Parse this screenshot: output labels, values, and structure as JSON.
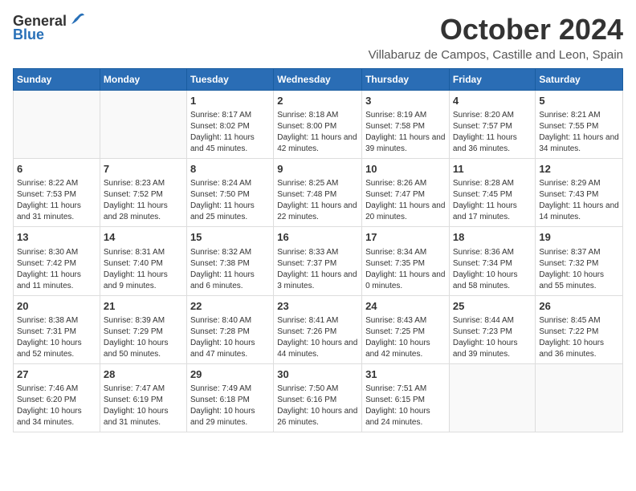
{
  "header": {
    "logo_general": "General",
    "logo_blue": "Blue",
    "month_title": "October 2024",
    "location": "Villabaruz de Campos, Castille and Leon, Spain"
  },
  "weekdays": [
    "Sunday",
    "Monday",
    "Tuesday",
    "Wednesday",
    "Thursday",
    "Friday",
    "Saturday"
  ],
  "weeks": [
    [
      {
        "day": "",
        "sunrise": "",
        "sunset": "",
        "daylight": ""
      },
      {
        "day": "",
        "sunrise": "",
        "sunset": "",
        "daylight": ""
      },
      {
        "day": "1",
        "sunrise": "Sunrise: 8:17 AM",
        "sunset": "Sunset: 8:02 PM",
        "daylight": "Daylight: 11 hours and 45 minutes."
      },
      {
        "day": "2",
        "sunrise": "Sunrise: 8:18 AM",
        "sunset": "Sunset: 8:00 PM",
        "daylight": "Daylight: 11 hours and 42 minutes."
      },
      {
        "day": "3",
        "sunrise": "Sunrise: 8:19 AM",
        "sunset": "Sunset: 7:58 PM",
        "daylight": "Daylight: 11 hours and 39 minutes."
      },
      {
        "day": "4",
        "sunrise": "Sunrise: 8:20 AM",
        "sunset": "Sunset: 7:57 PM",
        "daylight": "Daylight: 11 hours and 36 minutes."
      },
      {
        "day": "5",
        "sunrise": "Sunrise: 8:21 AM",
        "sunset": "Sunset: 7:55 PM",
        "daylight": "Daylight: 11 hours and 34 minutes."
      }
    ],
    [
      {
        "day": "6",
        "sunrise": "Sunrise: 8:22 AM",
        "sunset": "Sunset: 7:53 PM",
        "daylight": "Daylight: 11 hours and 31 minutes."
      },
      {
        "day": "7",
        "sunrise": "Sunrise: 8:23 AM",
        "sunset": "Sunset: 7:52 PM",
        "daylight": "Daylight: 11 hours and 28 minutes."
      },
      {
        "day": "8",
        "sunrise": "Sunrise: 8:24 AM",
        "sunset": "Sunset: 7:50 PM",
        "daylight": "Daylight: 11 hours and 25 minutes."
      },
      {
        "day": "9",
        "sunrise": "Sunrise: 8:25 AM",
        "sunset": "Sunset: 7:48 PM",
        "daylight": "Daylight: 11 hours and 22 minutes."
      },
      {
        "day": "10",
        "sunrise": "Sunrise: 8:26 AM",
        "sunset": "Sunset: 7:47 PM",
        "daylight": "Daylight: 11 hours and 20 minutes."
      },
      {
        "day": "11",
        "sunrise": "Sunrise: 8:28 AM",
        "sunset": "Sunset: 7:45 PM",
        "daylight": "Daylight: 11 hours and 17 minutes."
      },
      {
        "day": "12",
        "sunrise": "Sunrise: 8:29 AM",
        "sunset": "Sunset: 7:43 PM",
        "daylight": "Daylight: 11 hours and 14 minutes."
      }
    ],
    [
      {
        "day": "13",
        "sunrise": "Sunrise: 8:30 AM",
        "sunset": "Sunset: 7:42 PM",
        "daylight": "Daylight: 11 hours and 11 minutes."
      },
      {
        "day": "14",
        "sunrise": "Sunrise: 8:31 AM",
        "sunset": "Sunset: 7:40 PM",
        "daylight": "Daylight: 11 hours and 9 minutes."
      },
      {
        "day": "15",
        "sunrise": "Sunrise: 8:32 AM",
        "sunset": "Sunset: 7:38 PM",
        "daylight": "Daylight: 11 hours and 6 minutes."
      },
      {
        "day": "16",
        "sunrise": "Sunrise: 8:33 AM",
        "sunset": "Sunset: 7:37 PM",
        "daylight": "Daylight: 11 hours and 3 minutes."
      },
      {
        "day": "17",
        "sunrise": "Sunrise: 8:34 AM",
        "sunset": "Sunset: 7:35 PM",
        "daylight": "Daylight: 11 hours and 0 minutes."
      },
      {
        "day": "18",
        "sunrise": "Sunrise: 8:36 AM",
        "sunset": "Sunset: 7:34 PM",
        "daylight": "Daylight: 10 hours and 58 minutes."
      },
      {
        "day": "19",
        "sunrise": "Sunrise: 8:37 AM",
        "sunset": "Sunset: 7:32 PM",
        "daylight": "Daylight: 10 hours and 55 minutes."
      }
    ],
    [
      {
        "day": "20",
        "sunrise": "Sunrise: 8:38 AM",
        "sunset": "Sunset: 7:31 PM",
        "daylight": "Daylight: 10 hours and 52 minutes."
      },
      {
        "day": "21",
        "sunrise": "Sunrise: 8:39 AM",
        "sunset": "Sunset: 7:29 PM",
        "daylight": "Daylight: 10 hours and 50 minutes."
      },
      {
        "day": "22",
        "sunrise": "Sunrise: 8:40 AM",
        "sunset": "Sunset: 7:28 PM",
        "daylight": "Daylight: 10 hours and 47 minutes."
      },
      {
        "day": "23",
        "sunrise": "Sunrise: 8:41 AM",
        "sunset": "Sunset: 7:26 PM",
        "daylight": "Daylight: 10 hours and 44 minutes."
      },
      {
        "day": "24",
        "sunrise": "Sunrise: 8:43 AM",
        "sunset": "Sunset: 7:25 PM",
        "daylight": "Daylight: 10 hours and 42 minutes."
      },
      {
        "day": "25",
        "sunrise": "Sunrise: 8:44 AM",
        "sunset": "Sunset: 7:23 PM",
        "daylight": "Daylight: 10 hours and 39 minutes."
      },
      {
        "day": "26",
        "sunrise": "Sunrise: 8:45 AM",
        "sunset": "Sunset: 7:22 PM",
        "daylight": "Daylight: 10 hours and 36 minutes."
      }
    ],
    [
      {
        "day": "27",
        "sunrise": "Sunrise: 7:46 AM",
        "sunset": "Sunset: 6:20 PM",
        "daylight": "Daylight: 10 hours and 34 minutes."
      },
      {
        "day": "28",
        "sunrise": "Sunrise: 7:47 AM",
        "sunset": "Sunset: 6:19 PM",
        "daylight": "Daylight: 10 hours and 31 minutes."
      },
      {
        "day": "29",
        "sunrise": "Sunrise: 7:49 AM",
        "sunset": "Sunset: 6:18 PM",
        "daylight": "Daylight: 10 hours and 29 minutes."
      },
      {
        "day": "30",
        "sunrise": "Sunrise: 7:50 AM",
        "sunset": "Sunset: 6:16 PM",
        "daylight": "Daylight: 10 hours and 26 minutes."
      },
      {
        "day": "31",
        "sunrise": "Sunrise: 7:51 AM",
        "sunset": "Sunset: 6:15 PM",
        "daylight": "Daylight: 10 hours and 24 minutes."
      },
      {
        "day": "",
        "sunrise": "",
        "sunset": "",
        "daylight": ""
      },
      {
        "day": "",
        "sunrise": "",
        "sunset": "",
        "daylight": ""
      }
    ]
  ]
}
